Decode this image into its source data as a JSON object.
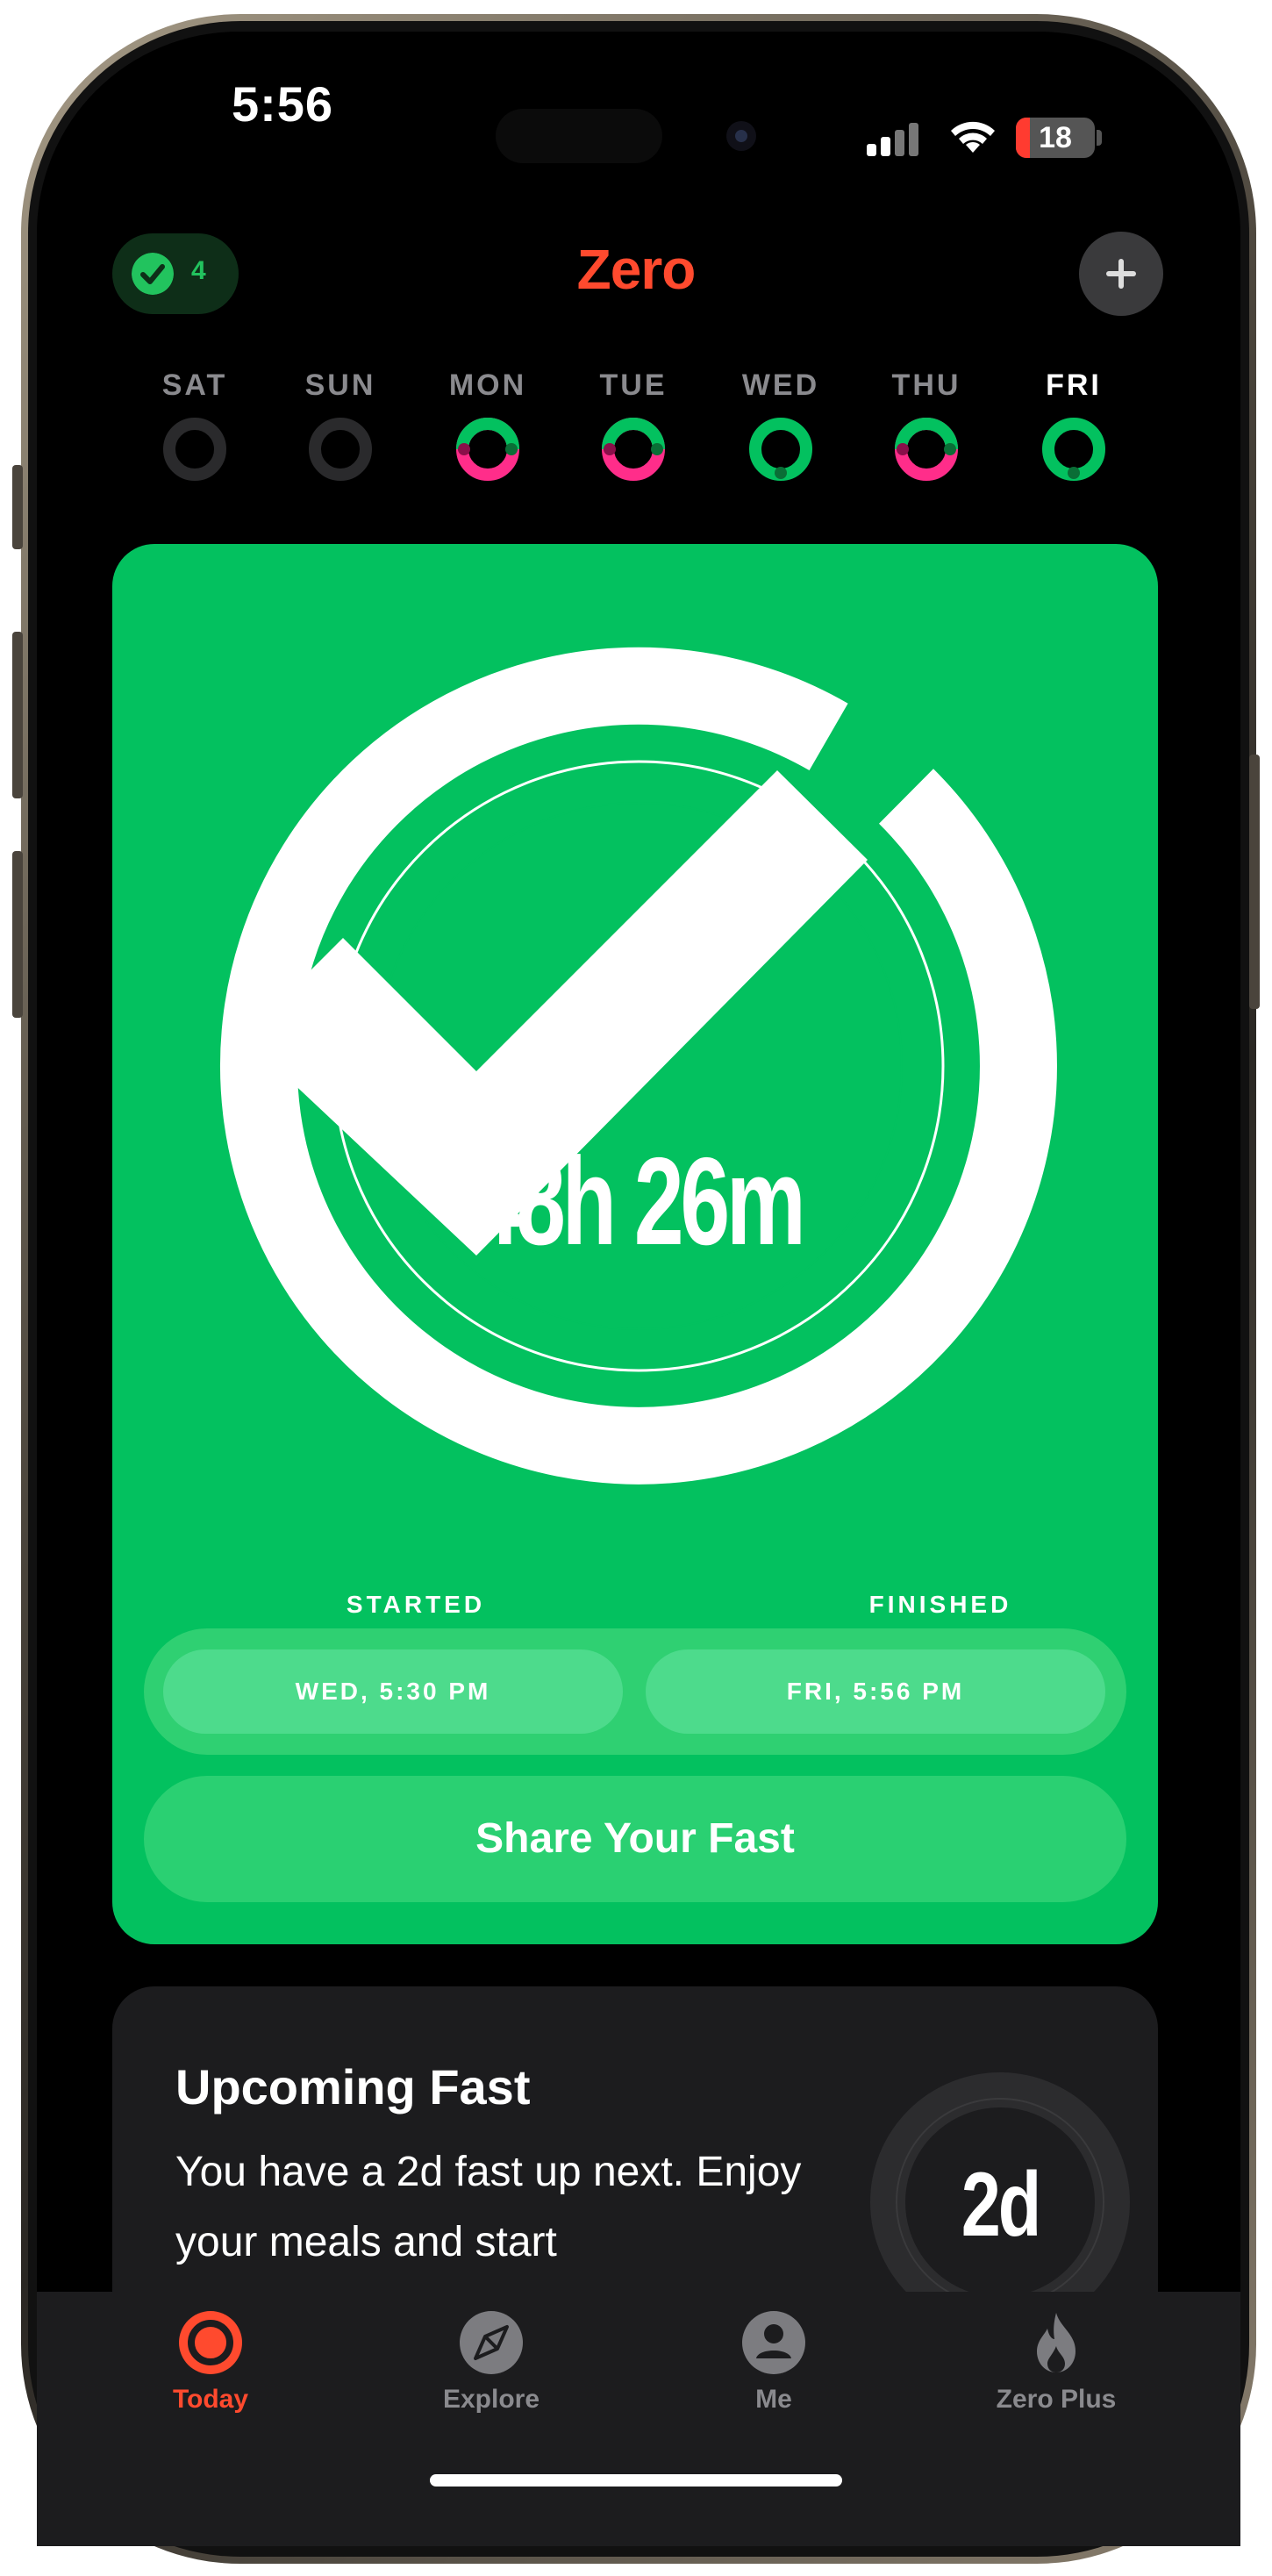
{
  "status_bar": {
    "time": "5:56",
    "battery": "18",
    "battery_level": 0.18
  },
  "header": {
    "streak_count": "4",
    "title": "Zero",
    "add_icon": "plus-icon",
    "streak_icon": "checkmark-icon"
  },
  "week": [
    {
      "label": "SAT",
      "state": "empty"
    },
    {
      "label": "SUN",
      "state": "empty"
    },
    {
      "label": "MON",
      "state": "partial"
    },
    {
      "label": "TUE",
      "state": "partial"
    },
    {
      "label": "WED",
      "state": "complete"
    },
    {
      "label": "THU",
      "state": "partial"
    },
    {
      "label": "FRI",
      "state": "complete",
      "active": true
    }
  ],
  "completed_fast": {
    "duration": "48h 26m",
    "started_label": "STARTED",
    "finished_label": "FINISHED",
    "started_value": "WED, 5:30 PM",
    "finished_value": "FRI, 5:56 PM",
    "share_label": "Share Your Fast"
  },
  "upcoming": {
    "title": "Upcoming Fast",
    "body": "You have a 2d fast up next. Enjoy your meals and start",
    "ring_label": "2d"
  },
  "tabs": [
    {
      "label": "Today",
      "icon": "ring-icon",
      "active": true
    },
    {
      "label": "Explore",
      "icon": "compass-icon"
    },
    {
      "label": "Me",
      "icon": "person-icon"
    },
    {
      "label": "Zero Plus",
      "icon": "flame-icon"
    }
  ],
  "colors": {
    "brand": "#ff4a2e",
    "success": "#03c15f",
    "partial": "#ff2d8a",
    "background": "#000000"
  }
}
